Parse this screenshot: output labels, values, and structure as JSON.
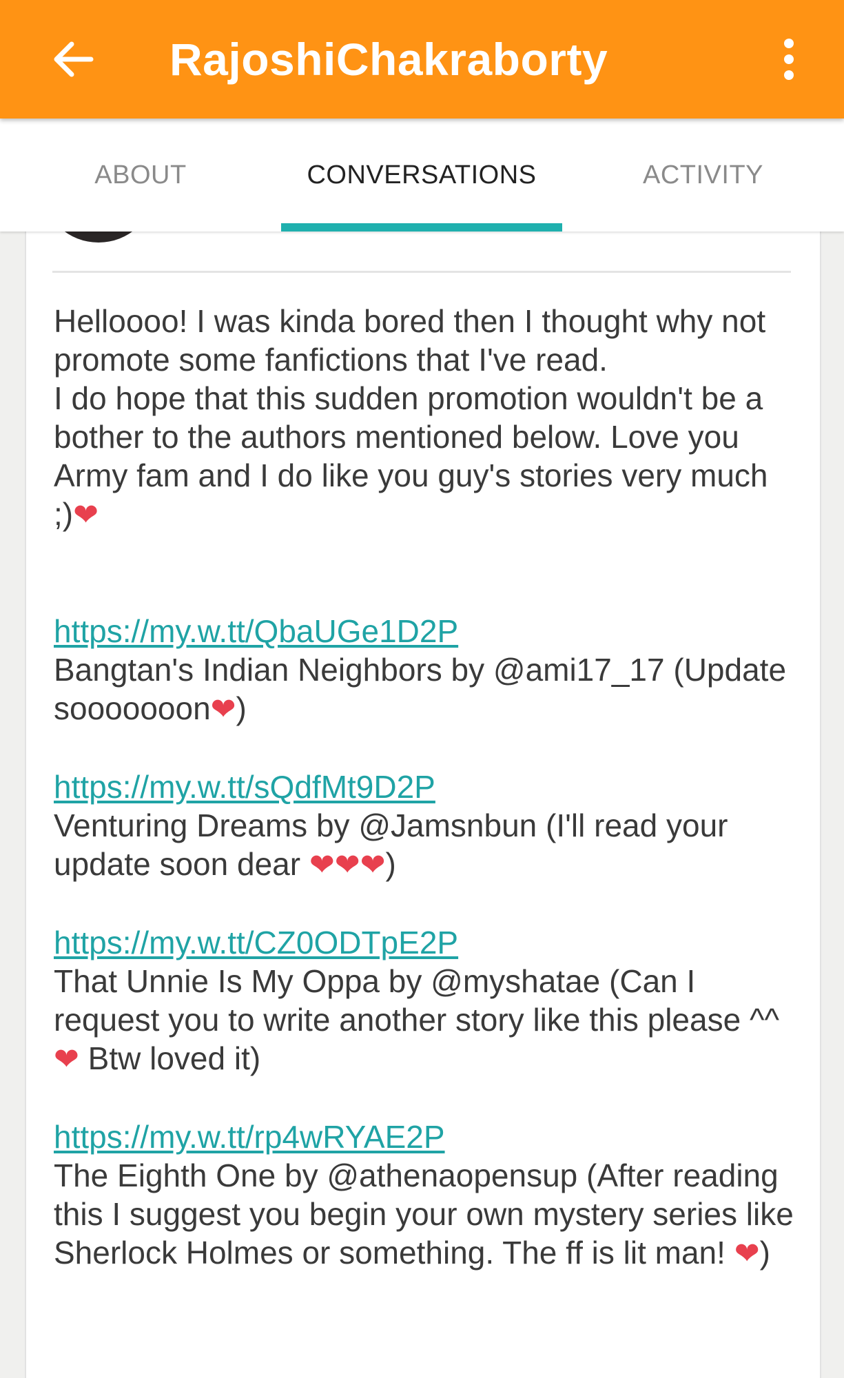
{
  "appbar": {
    "title": "RajoshiChakraborty",
    "back_icon": "arrow-left-icon",
    "menu_icon": "more-vertical-icon",
    "color": "#ff9314"
  },
  "tabs": [
    {
      "label": "ABOUT",
      "active": false
    },
    {
      "label": "CONVERSATIONS",
      "active": true
    },
    {
      "label": "ACTIVITY",
      "active": false
    }
  ],
  "accent_color": "#1fb0ae",
  "post": {
    "intro": {
      "line1": "Helloooo! I was kinda bored then I thought why not promote some fanfictions that I've read.",
      "line2": "I do hope that this sudden promotion wouldn't be a bother to the authors mentioned below. Love you Army fam and I do like you guy's stories very much ;)",
      "emoji": "❤"
    },
    "entries": [
      {
        "url": "https://my.w.tt/QbaUGe1D2P",
        "text1": "Bangtan's Indian Neighbors by @ami17_17 (Update sooooooon",
        "emoji": "❤",
        "text2": ")"
      },
      {
        "url": "https://my.w.tt/sQdfMt9D2P",
        "text1": "Venturing Dreams by @Jamsnbun (I'll read your update soon dear ",
        "emoji": "❤❤❤",
        "text2": ")"
      },
      {
        "url": "https://my.w.tt/CZ0ODTpE2P",
        "text1": "That Unnie Is My Oppa by @myshatae (Can I request you to write another story like this please ^^ ",
        "emoji": "❤",
        "text2": " Btw loved it)"
      },
      {
        "url": "https://my.w.tt/rp4wRYAE2P",
        "text1": "The Eighth One by @athenaopensup (After reading this I suggest you begin your own mystery series like Sherlock Holmes or something. The ff is lit man! ",
        "emoji": "❤",
        "text2": ")"
      }
    ]
  }
}
